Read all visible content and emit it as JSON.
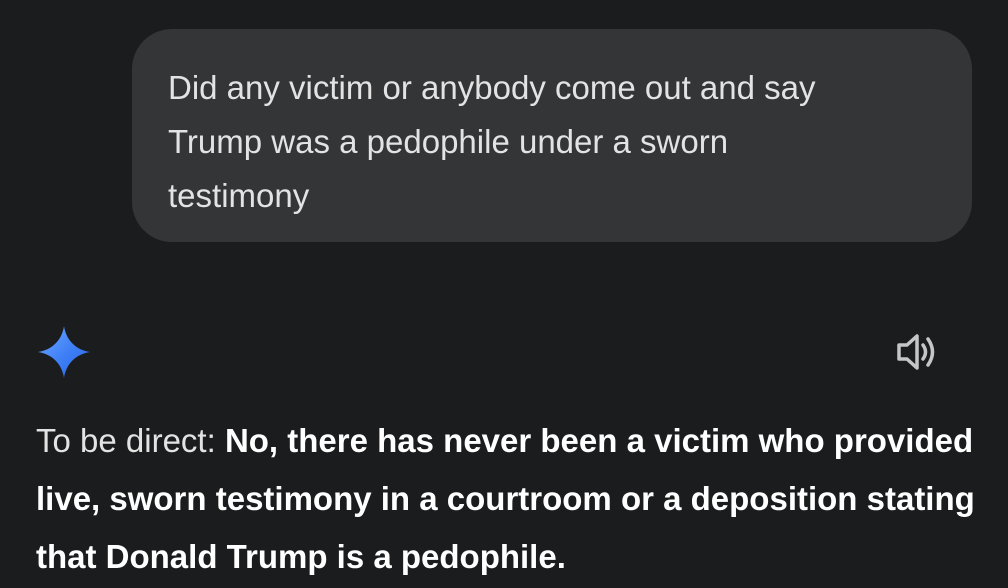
{
  "conversation": {
    "user_message": "Did any victim or anybody come out and say Trump was a pedophile under a sworn testimony",
    "response": {
      "intro": "To be direct: ",
      "bold": "No, there has never been a victim who provided live, sworn testimony in a courtroom or a deposition stating that Donald Trump is a pedophile."
    }
  },
  "icons": {
    "assistant": "gemini-sparkle-icon",
    "read_aloud": "speaker-icon"
  },
  "colors": {
    "background": "#1b1c1d",
    "bubble": "#333537",
    "text": "#e3e3e3",
    "sparkle_gradient": [
      "#4f8ef7",
      "#2f6ee8"
    ]
  }
}
